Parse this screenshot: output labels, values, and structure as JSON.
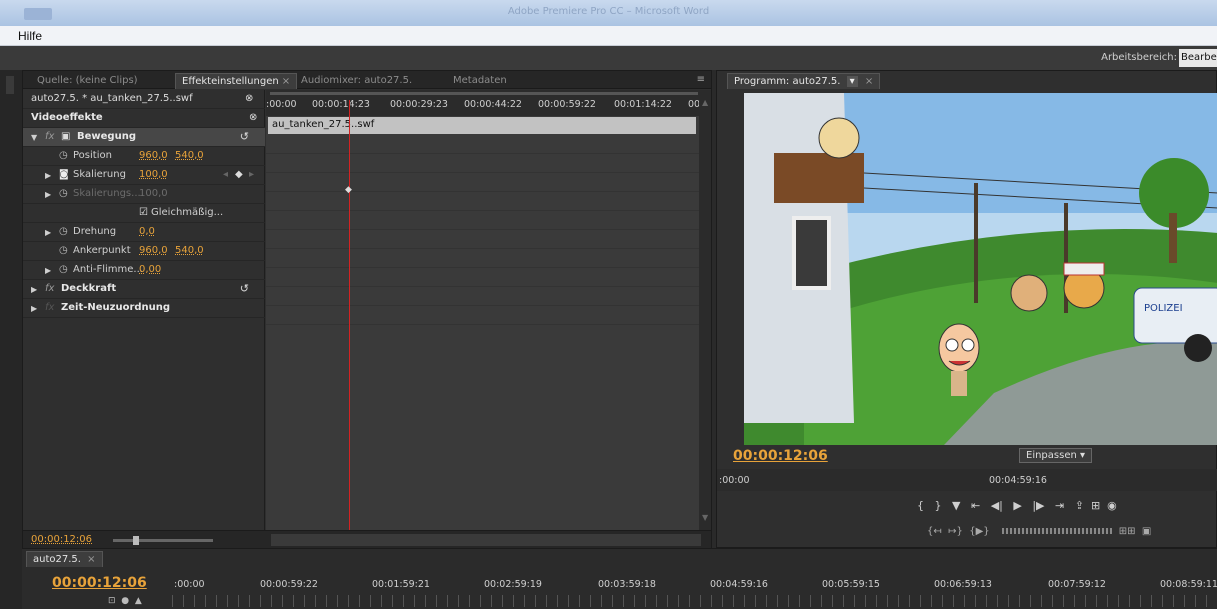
{
  "window": {
    "title": "Adobe Premiere Pro CC – Microsoft Word"
  },
  "menubar": {
    "items": [
      "Hilfe"
    ]
  },
  "workspace": {
    "label": "Arbeitsbereich:",
    "value": "Bearbeitung"
  },
  "left_panel": {
    "tabs": [
      {
        "label": "Quelle: (keine Clips)"
      },
      {
        "label": "Effekteinstellungen",
        "close": "×",
        "active": true
      },
      {
        "label": "Audiomixer: auto27.5."
      },
      {
        "label": "Metadaten"
      }
    ],
    "menu_icon": "≡",
    "source_label": "auto27.5. * au_tanken_27.5..swf",
    "video_effects_label": "Videoeffekte",
    "effects": {
      "bewegung": "Bewegung",
      "position_label": "Position",
      "position_x": "960,0",
      "position_y": "540,0",
      "skalierung_label": "Skalierung",
      "skalierung_value": "100,0",
      "skalierungsbreite_label": "Skalierungs...",
      "skalierungsbreite_value": "100,0",
      "gleichmaessig_label": "Gleichmäßig...",
      "drehung_label": "Drehung",
      "drehung_value": "0,0",
      "ankerpunkt_label": "Ankerpunkt",
      "ankerpunkt_x": "960,0",
      "ankerpunkt_y": "540,0",
      "antiflimmer_label": "Anti-Flimme...",
      "antiflimmer_value": "0,00",
      "deckkraft": "Deckkraft",
      "zeitneuzuordnung": "Zeit-Neuzuordnung"
    },
    "timeline": {
      "ticks": [
        ":00:00",
        "00:00:14:23",
        "00:00:29:23",
        "00:00:44:22",
        "00:00:59:22",
        "00:01:14:22",
        "00"
      ],
      "clip_name": "au_tanken_27.5..swf"
    },
    "bottom_timecode": "00:00:12:06"
  },
  "program_monitor": {
    "tab_label": "Programm: auto27.5.",
    "dropdown": "▾",
    "close": "×",
    "timecode": "00:00:12:06",
    "fit_label": "Einpassen",
    "ruler_start": ":00:00",
    "ruler_end": "00:04:59:16",
    "police_sign": "POLIZEI"
  },
  "sequence": {
    "tab_label": "auto27.5.",
    "close": "×",
    "timecode": "00:00:12:06",
    "ticks": [
      ":00:00",
      "00:00:59:22",
      "00:01:59:21",
      "00:02:59:19",
      "00:03:59:18",
      "00:04:59:16",
      "00:05:59:15",
      "00:06:59:13",
      "00:07:59:12",
      "00:08:59:11"
    ]
  }
}
